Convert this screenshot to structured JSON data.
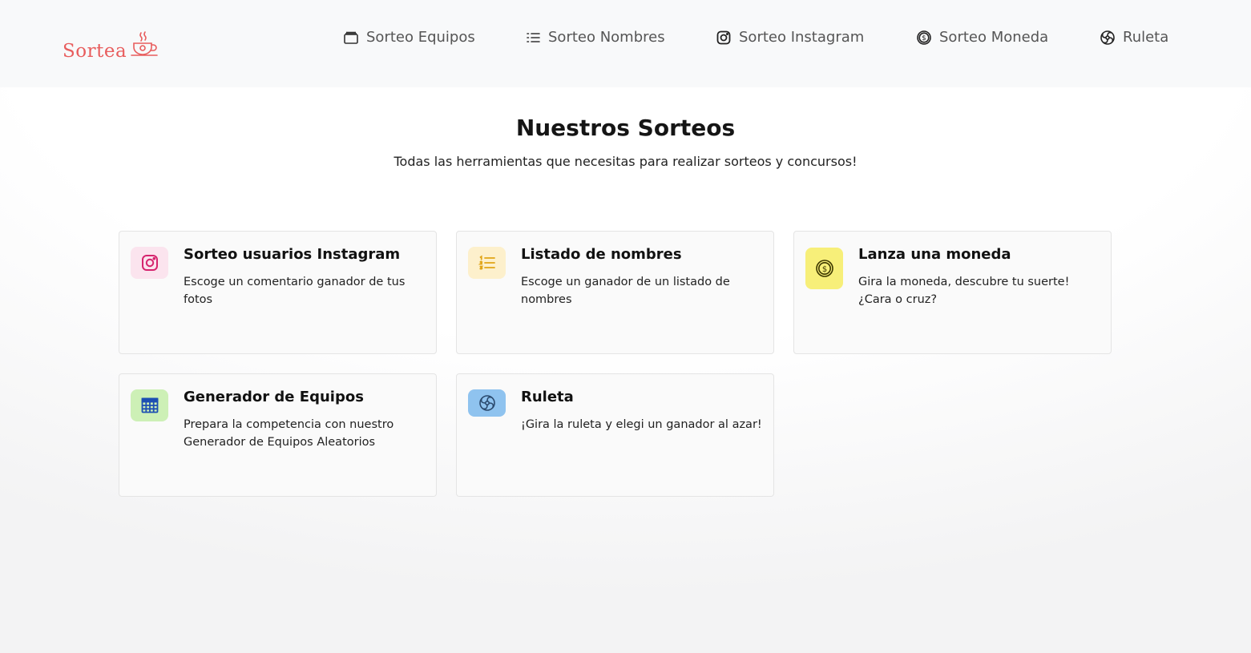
{
  "brand": {
    "name": "Sortea",
    "icon": "coffee-cup-icon",
    "color": "#e85d5d"
  },
  "nav": {
    "items": [
      {
        "label": "Sorteo Equipos",
        "icon": "briefcase-icon"
      },
      {
        "label": "Sorteo Nombres",
        "icon": "list-icon"
      },
      {
        "label": "Sorteo Instagram",
        "icon": "instagram-icon"
      },
      {
        "label": "Sorteo Moneda",
        "icon": "coin-icon"
      },
      {
        "label": "Ruleta",
        "icon": "wheel-icon"
      }
    ]
  },
  "main": {
    "title": "Nuestros Sorteos",
    "subtitle": "Todas las herramientas que necesitas para realizar sorteos y concursos!"
  },
  "cards": [
    {
      "title": "Sorteo usuarios Instagram",
      "description": "Escoge un comentario ganador de tus fotos",
      "icon": "instagram-icon",
      "icon_bg": "#fbe4ee",
      "icon_color": "#d6246e"
    },
    {
      "title": "Listado de nombres",
      "description": "Escoge un ganador de un listado de nombres",
      "icon": "list-icon",
      "icon_bg": "#fdf0cc",
      "icon_color": "#e0a416"
    },
    {
      "title": "Lanza una moneda",
      "description": "Gira la moneda, descubre tu suerte! ¿Cara o cruz?",
      "icon": "coin-icon",
      "icon_bg": "#f7ef79",
      "icon_color": "#5a5200"
    },
    {
      "title": "Generador de Equipos",
      "description": "Prepara la competencia con nuestro Generador de Equipos Aleatorios",
      "icon": "table-icon",
      "icon_bg": "#cdf0b6",
      "icon_color": "#1d4fb3"
    },
    {
      "title": "Ruleta",
      "description": "¡Gira la ruleta y elegi un ganador al azar!",
      "icon": "wheel-icon",
      "icon_bg": "#8fc3ef",
      "icon_color": "#2b4a6e"
    }
  ]
}
